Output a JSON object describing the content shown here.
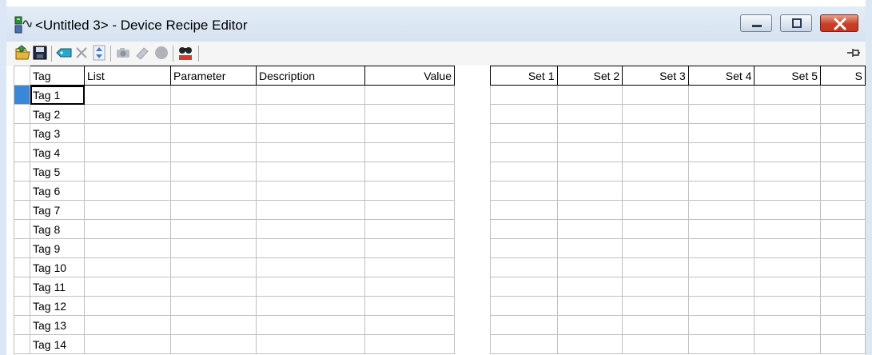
{
  "window": {
    "title": "<Untitled 3> - Device Recipe Editor"
  },
  "toolbar": {
    "buttons": [
      {
        "name": "open-icon"
      },
      {
        "name": "save-icon"
      },
      {
        "name": "add-tag-icon"
      },
      {
        "name": "delete-icon"
      },
      {
        "name": "move-up-down-icon"
      },
      {
        "name": "camera-icon"
      },
      {
        "name": "eraser-icon"
      },
      {
        "name": "record-icon"
      },
      {
        "name": "find-opc-icon"
      }
    ],
    "pin_icon": "pin-icon"
  },
  "left_grid": {
    "columns": [
      "Tag",
      "List",
      "Parameter",
      "Description",
      "Value"
    ],
    "rows": [
      "Tag 1",
      "Tag 2",
      "Tag 3",
      "Tag 4",
      "Tag 5",
      "Tag 6",
      "Tag 7",
      "Tag 8",
      "Tag 9",
      "Tag 10",
      "Tag 11",
      "Tag 12",
      "Tag 13",
      "Tag 14"
    ]
  },
  "right_grid": {
    "columns": [
      "Set 1",
      "Set 2",
      "Set 3",
      "Set 4",
      "Set 5",
      "S"
    ]
  },
  "colors": {
    "selection": "#3a86d8",
    "close_button": "#c8402a"
  }
}
